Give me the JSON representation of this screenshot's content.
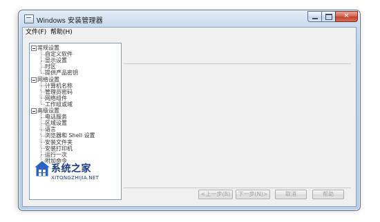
{
  "window": {
    "title": "Windows 安装管理器",
    "controls": {
      "close_glyph": "✕"
    }
  },
  "menu": [
    "文件(F)",
    "帮助(H)"
  ],
  "tree": [
    {
      "label": "常规设置",
      "expanded": true,
      "children": [
        "自定义软件",
        "显示设置",
        "时区",
        "提供产品密钥"
      ]
    },
    {
      "label": "网络设置",
      "expanded": true,
      "children": [
        "计算机名称",
        "管理员密码",
        "网络组件",
        "工作组或域"
      ]
    },
    {
      "label": "高级设置",
      "expanded": true,
      "children": [
        "电话服务",
        "区域设置",
        "语言",
        "浏览器和 Shell 设置",
        "安装文件夹",
        "安装打印机",
        "运行一次",
        "附加命令"
      ]
    }
  ],
  "buttons": {
    "prev": "<上一步(B)",
    "next": "下一步(N)>",
    "cancel": "取消",
    "help": "帮助"
  },
  "watermark": {
    "cn": "系统之家",
    "en": "XITONGZHIJIA.NET"
  },
  "colors": {
    "titlebar": "#c8d9ec",
    "client_bg": "#f0f0f0",
    "close_button": "#c2402a",
    "watermark": "#1c3c82"
  }
}
